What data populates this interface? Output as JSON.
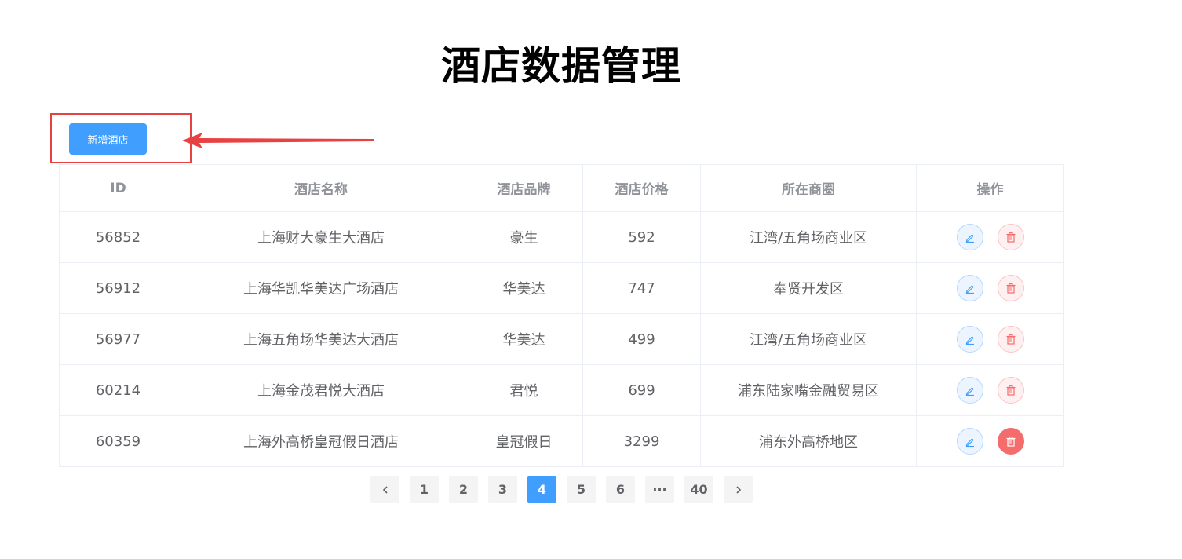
{
  "page": {
    "title": "酒店数据管理"
  },
  "toolbar": {
    "add_label": "新增酒店"
  },
  "table": {
    "columns": [
      "ID",
      "酒店名称",
      "酒店品牌",
      "酒店价格",
      "所在商圈",
      "操作"
    ],
    "rows": [
      {
        "id": "56852",
        "name": "上海财大豪生大酒店",
        "brand": "豪生",
        "price": "592",
        "area": "江湾/五角场商业区"
      },
      {
        "id": "56912",
        "name": "上海华凯华美达广场酒店",
        "brand": "华美达",
        "price": "747",
        "area": "奉贤开发区"
      },
      {
        "id": "56977",
        "name": "上海五角场华美达大酒店",
        "brand": "华美达",
        "price": "499",
        "area": "江湾/五角场商业区"
      },
      {
        "id": "60214",
        "name": "上海金茂君悦大酒店",
        "brand": "君悦",
        "price": "699",
        "area": "浦东陆家嘴金融贸易区"
      },
      {
        "id": "60359",
        "name": "上海外高桥皇冠假日酒店",
        "brand": "皇冠假日",
        "price": "3299",
        "area": "浦东外高桥地区"
      }
    ]
  },
  "pagination": {
    "pages": [
      "1",
      "2",
      "3",
      "4",
      "5",
      "6",
      "···",
      "40"
    ],
    "current": "4"
  },
  "icons": {
    "edit": "edit-icon",
    "delete": "delete-icon",
    "prev": "chevron-left-icon",
    "next": "chevron-right-icon"
  },
  "colors": {
    "primary": "#409eff",
    "danger": "#f56c6c",
    "annotation": "#e84142"
  }
}
